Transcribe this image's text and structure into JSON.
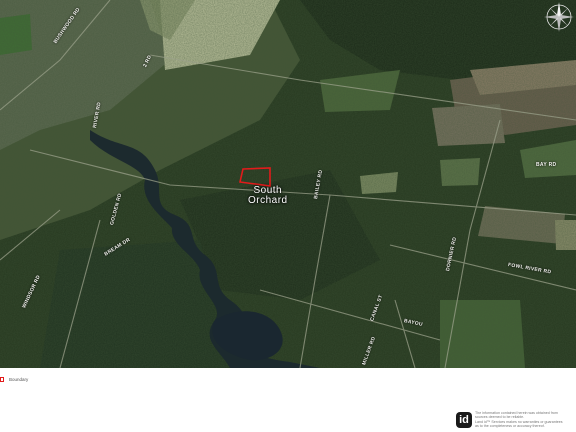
{
  "map": {
    "area_label_line1": "South",
    "area_label_line2": "Orchard",
    "road_labels": [
      "BUSHWOOD RD",
      "2 RD",
      "BAY RD",
      "BAILEY RD",
      "GOLDEN RD",
      "BREAM DR",
      "WINDSOR RD",
      "FOWL RIVER RD",
      "DORNIER RD",
      "CANAL ST",
      "BAYOU",
      "MILLER RD",
      "RIVER RD"
    ],
    "colors": {
      "parcel_outline": "#e21b1b",
      "water": "#1c2a2e",
      "forest": "#223420",
      "field": "#b9bf9a"
    },
    "compass_icon": "compass-rose-icon"
  },
  "legend": {
    "label": "Boundary"
  },
  "footer": {
    "brand": "id",
    "disclaimer_1": "The information contained herein was obtained from",
    "disclaimer_2": "sources deemed to be reliable.",
    "disclaimer_3": "Land id™ Services makes no warranties or guarantees",
    "disclaimer_4": "as to the completeness or accuracy thereof."
  }
}
